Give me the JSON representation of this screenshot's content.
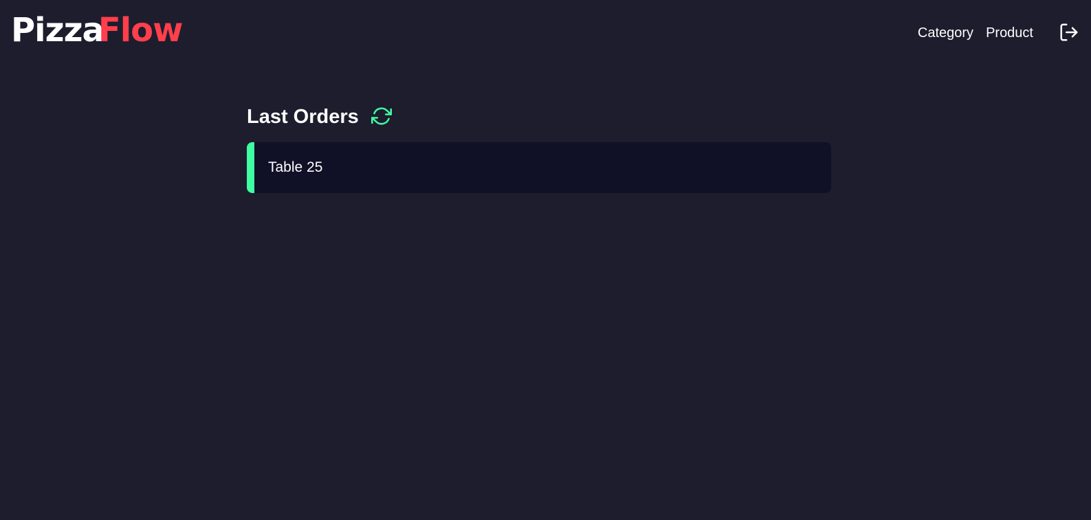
{
  "header": {
    "logo": {
      "part1": "Pizza",
      "part2": "Flow"
    },
    "nav": [
      {
        "label": "Category"
      },
      {
        "label": "Product"
      }
    ],
    "logout_icon": "logout-icon"
  },
  "main": {
    "title": "Last Orders",
    "refresh_icon": "refresh-icon",
    "orders": [
      {
        "label": "Table 25",
        "status_color": "#3fffa3"
      }
    ]
  },
  "colors": {
    "background": "#1d1d2e",
    "card": "#101026",
    "accent_red": "#ff3f4b",
    "accent_green": "#3fffa3",
    "text": "#ffffff"
  }
}
